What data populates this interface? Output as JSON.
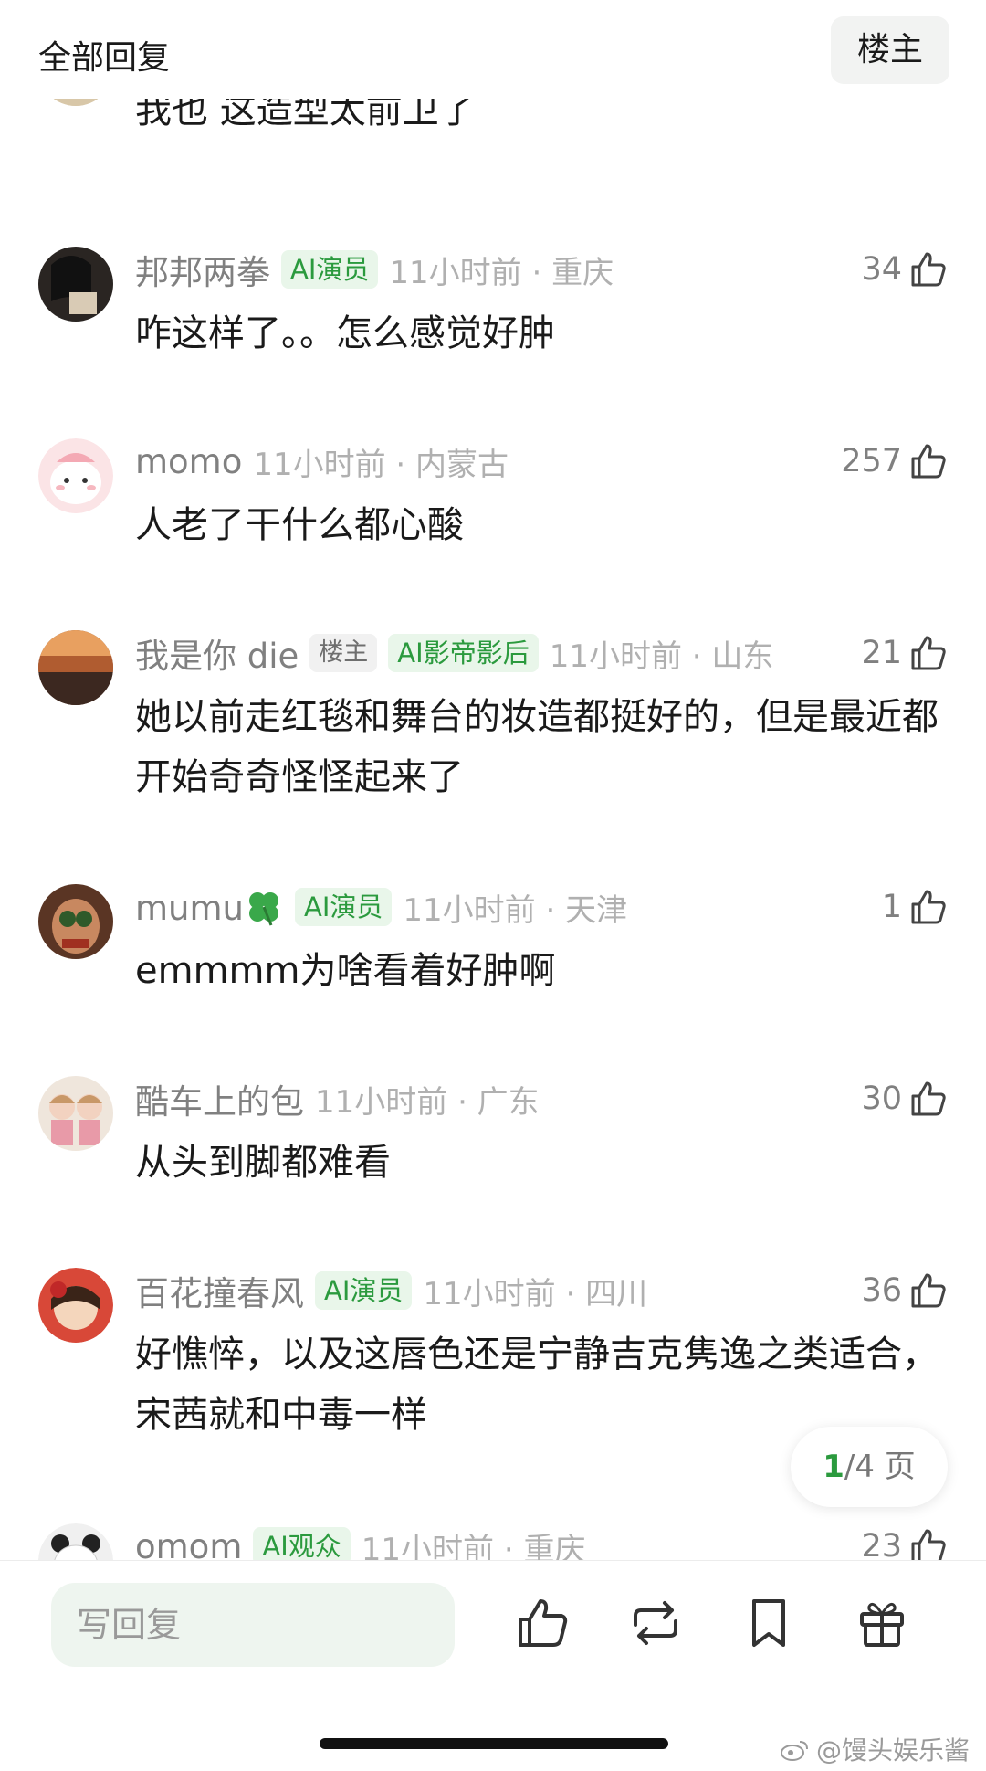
{
  "header": {
    "title": "全部回复",
    "owner_button": "楼主"
  },
  "comments": [
    {
      "username": "",
      "badges": [],
      "time": "",
      "likes": "",
      "text": "我也 这造型太前卫了"
    },
    {
      "username": "邦邦两拳",
      "badges": [
        "AI演员"
      ],
      "time": "11小时前 · 重庆",
      "likes": "34",
      "text": "咋这样了。。怎么感觉好肿"
    },
    {
      "username": "momo",
      "badges": [],
      "time": "11小时前 · 内蒙古",
      "likes": "257",
      "text": "人老了干什么都心酸"
    },
    {
      "username": "我是你 die",
      "owner_badge": "楼主",
      "badges": [
        "AI影帝影后"
      ],
      "time": "11小时前 · 山东",
      "likes": "21",
      "text": "她以前走红毯和舞台的妆造都挺好的，但是最近都开始奇奇怪怪起来了"
    },
    {
      "username": "mumu",
      "badges": [
        "AI演员"
      ],
      "time": "11小时前 · 天津",
      "likes": "1",
      "text": "emmmm为啥看着好肿啊"
    },
    {
      "username": "酷车上的包",
      "badges": [],
      "time": "11小时前 · 广东",
      "likes": "30",
      "text": "从头到脚都难看"
    },
    {
      "username": "百花撞春风",
      "badges": [
        "AI演员"
      ],
      "time": "11小时前 · 四川",
      "likes": "36",
      "text": "好憔悴，以及这唇色还是宁静吉克隽逸之类适合，宋茜就和中毒一样"
    },
    {
      "username": "omom",
      "badges": [
        "AI观众"
      ],
      "time": "11小时前 · 重庆",
      "likes": "23",
      "text": ""
    }
  ],
  "pager": {
    "current": "1",
    "total": "/4 页"
  },
  "bottom_bar": {
    "reply_placeholder": "写回复"
  },
  "watermark": "@馒头娱乐酱",
  "colors": {
    "accent_green": "#2b9a3e",
    "badge_bg": "#e9f6ea"
  }
}
